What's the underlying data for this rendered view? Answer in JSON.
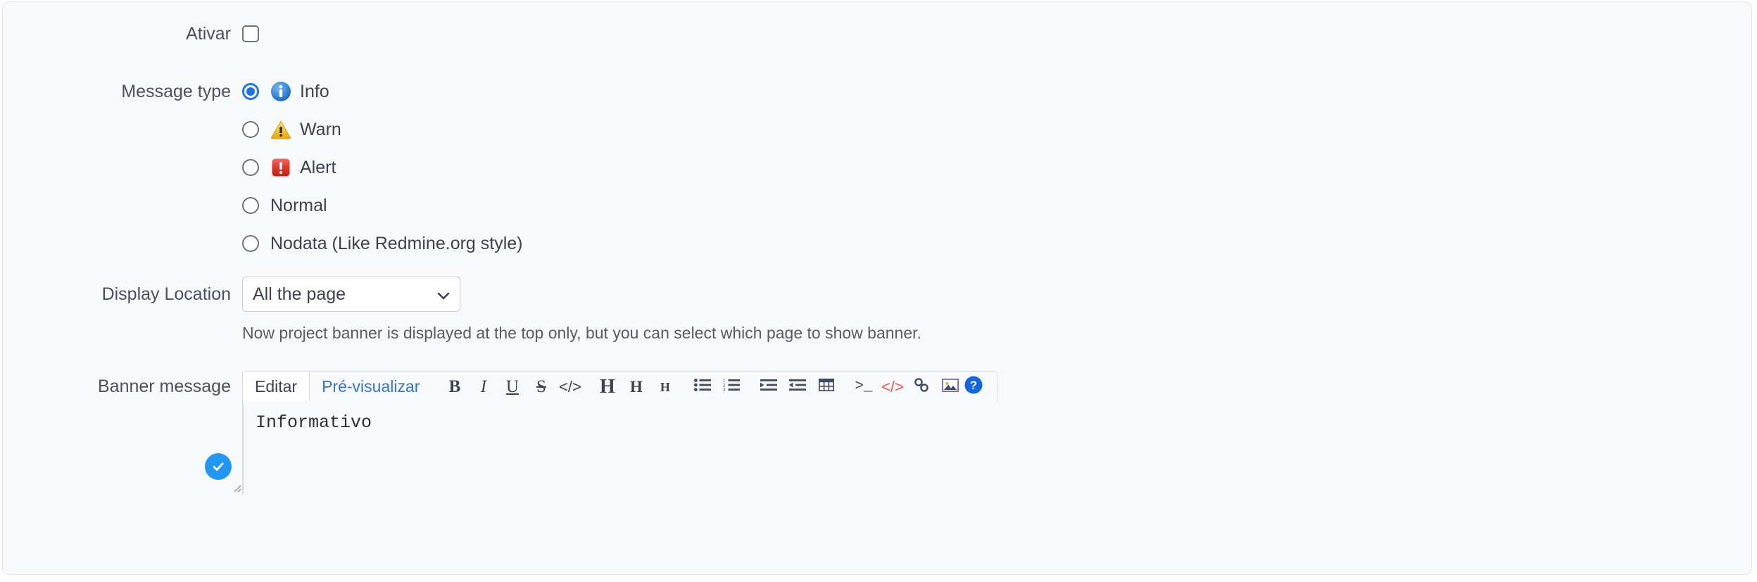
{
  "form": {
    "enable": {
      "label": "Ativar",
      "checked": false
    },
    "message_type": {
      "label": "Message type",
      "selected": "info",
      "options": [
        {
          "id": "info",
          "label": "Info",
          "icon": "info-icon"
        },
        {
          "id": "warn",
          "label": "Warn",
          "icon": "warning-triangle-icon"
        },
        {
          "id": "alert",
          "label": "Alert",
          "icon": "alert-exclamation-icon"
        },
        {
          "id": "normal",
          "label": "Normal",
          "icon": ""
        },
        {
          "id": "nodata",
          "label": "Nodata (Like Redmine.org style)",
          "icon": ""
        }
      ]
    },
    "display_location": {
      "label": "Display Location",
      "value": "All the page",
      "help": "Now project banner is displayed at the top only, but you can select which page to show banner."
    },
    "banner_message": {
      "label": "Banner message",
      "tabs": [
        {
          "id": "edit",
          "label": "Editar",
          "active": true
        },
        {
          "id": "preview",
          "label": "Pré-visualizar",
          "active": false
        }
      ],
      "toolbar": [
        {
          "name": "bold-button",
          "glyph": "B",
          "style": "bold"
        },
        {
          "name": "italic-button",
          "glyph": "I",
          "style": "ital"
        },
        {
          "name": "underline-button",
          "glyph": "U",
          "style": "und"
        },
        {
          "name": "strikethrough-button",
          "glyph": "S",
          "style": "strk"
        },
        {
          "name": "inline-code-button",
          "glyph": "</>",
          "style": "code"
        },
        {
          "name": "heading-1-button",
          "glyph": "H",
          "style": "h1"
        },
        {
          "name": "heading-2-button",
          "glyph": "H",
          "style": "h2"
        },
        {
          "name": "heading-3-button",
          "glyph": "H",
          "style": "h3"
        },
        {
          "name": "unordered-list-button",
          "glyph": "",
          "style": "svg-ul"
        },
        {
          "name": "ordered-list-button",
          "glyph": "",
          "style": "svg-ol"
        },
        {
          "name": "indent-button",
          "glyph": "",
          "style": "svg-indent"
        },
        {
          "name": "outdent-button",
          "glyph": "",
          "style": "svg-outdent"
        },
        {
          "name": "table-button",
          "glyph": "",
          "style": "svg-table"
        },
        {
          "name": "preformatted-button",
          "glyph": ">_",
          "style": "term"
        },
        {
          "name": "code-block-button",
          "glyph": "</>",
          "style": "red"
        },
        {
          "name": "link-button",
          "glyph": "",
          "style": "svg-link"
        },
        {
          "name": "image-button",
          "glyph": "",
          "style": "svg-image"
        }
      ],
      "help_icon": "help-circle-icon",
      "value": "Informativo",
      "status_badge": "check-circle-icon"
    }
  },
  "colors": {
    "accent_blue": "#1a73e8",
    "link_blue": "#3574c9",
    "info": "#2f80d8",
    "warn": "#f0b323",
    "alert": "#e03131",
    "badge_blue": "#2196f3",
    "help_blue": "#1565e0",
    "code_red": "#e2574c",
    "panel_bg": "#f8f9fb",
    "border": "#d7dae3"
  }
}
